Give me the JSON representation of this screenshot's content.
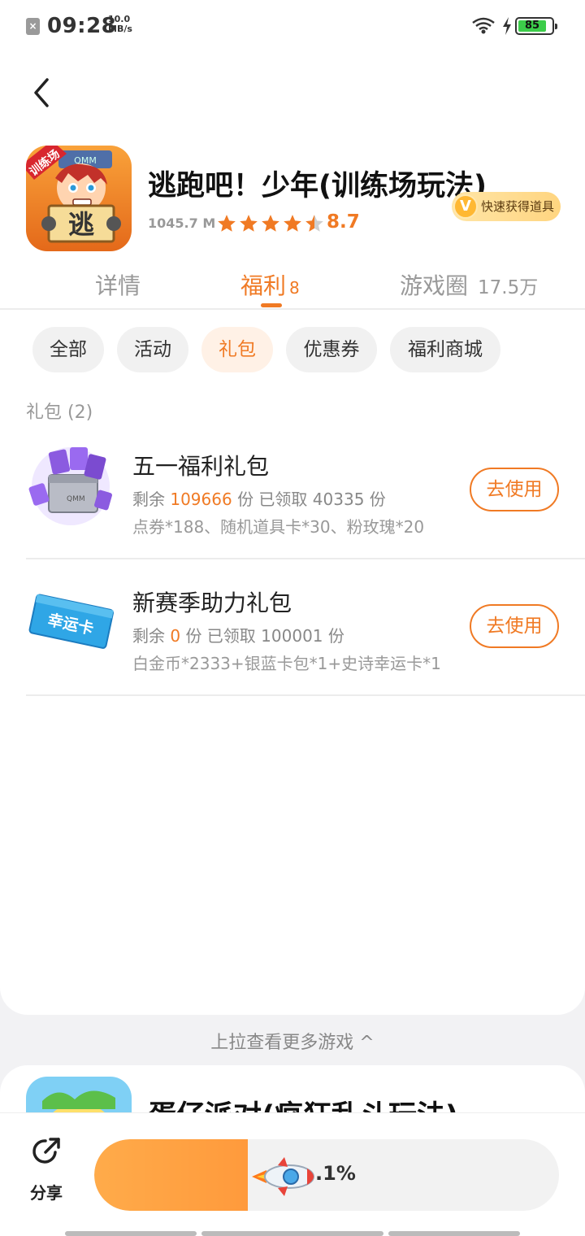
{
  "status": {
    "time": "09:28",
    "speed_value": "10.0",
    "speed_unit": "MB/s",
    "battery": "85",
    "battery_level": 0.85,
    "colors": {
      "battery": "#3ccd4a"
    }
  },
  "app": {
    "title": "逃跑吧！少年(训练场玩法)",
    "size": "1045.7 M",
    "rating": "8.7",
    "rating_stars": 4.5,
    "icon_badge": "训练场",
    "icon_sign": "逃",
    "icon_brand": "QMM",
    "quick_tag": "快速获得道具"
  },
  "tabs": [
    {
      "label": "详情"
    },
    {
      "label": "福利",
      "count": "8"
    },
    {
      "label": "游戏圈",
      "count": "17.5万"
    }
  ],
  "chips": [
    "全部",
    "活动",
    "礼包",
    "优惠券",
    "福利商城"
  ],
  "section_title": "礼包 (2)",
  "gifts": [
    {
      "name": "五一福利礼包",
      "remain_label": "剩余",
      "remain": "109666",
      "claimed_text": "份 已领取 40335 份",
      "items": "点券*188、随机道具卡*30、粉玫瑰*20",
      "button": "去使用"
    },
    {
      "name": "新赛季助力礼包",
      "remain_label": "剩余",
      "remain": "0",
      "claimed_text": "份 已领取 100001 份",
      "items": "白金币*2333+银蓝卡包*1+史诗幸运卡*1",
      "button": "去使用",
      "card_text": "幸运卡"
    }
  ],
  "pullup": "上拉查看更多游戏 ^",
  "next_game": {
    "title": "蛋仔派对(疯狂乱斗玩法)"
  },
  "bottom": {
    "share": "分享",
    "progress_text": ".1%",
    "progress_fraction": 0.33
  },
  "colors": {
    "accent": "#f07a24",
    "chip_active_bg": "#fff1e6"
  },
  "icons": [
    "back-icon",
    "share-icon",
    "star-icon",
    "wifi-icon",
    "charging-icon",
    "rocket-icon"
  ]
}
